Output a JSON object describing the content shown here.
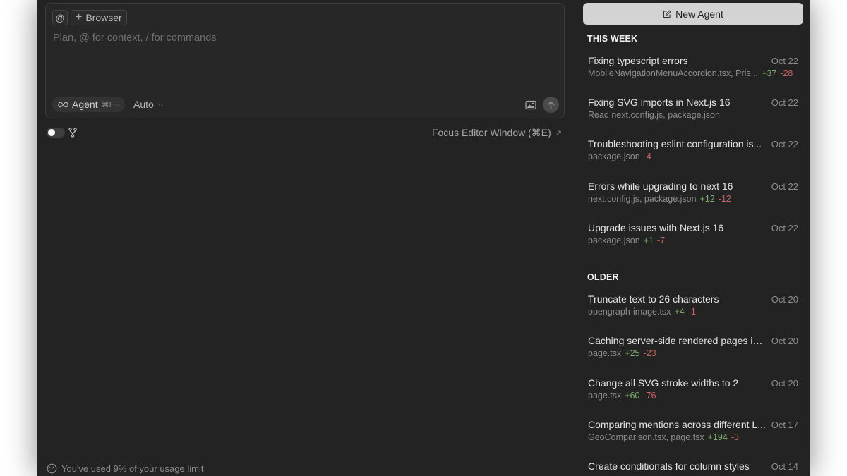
{
  "composer": {
    "at_label": "@",
    "browser_label": "Browser",
    "placeholder": "Plan, @ for context, / for commands",
    "mode_label": "Agent",
    "mode_shortcut": "⌘I",
    "model_label": "Auto"
  },
  "focus_editor": {
    "label": "Focus Editor Window (⌘E)"
  },
  "usage": {
    "text": "You've used 9% of your usage limit"
  },
  "sidebar": {
    "new_agent_label": "New Agent",
    "sections": [
      {
        "title": "THIS WEEK",
        "items": [
          {
            "title": "Fixing typescript errors",
            "date": "Oct 22",
            "files": "MobileNavigationMenuAccordion.tsx, Pris...",
            "add": "+37",
            "del": "-28"
          },
          {
            "title": "Fixing SVG imports in Next.js 16",
            "date": "Oct 22",
            "files": "Read next.config.js, package.json",
            "add": "",
            "del": ""
          },
          {
            "title": "Troubleshooting eslint configuration is...",
            "date": "Oct 22",
            "files": "package.json",
            "add": "",
            "del": "-4"
          },
          {
            "title": "Errors while upgrading to next 16",
            "date": "Oct 22",
            "files": "next.config.js, package.json",
            "add": "+12",
            "del": "-12"
          },
          {
            "title": "Upgrade issues with Next.js 16",
            "date": "Oct 22",
            "files": "package.json",
            "add": "+1",
            "del": "-7"
          }
        ]
      },
      {
        "title": "OLDER",
        "items": [
          {
            "title": "Truncate text to 26 characters",
            "date": "Oct 20",
            "files": "opengraph-image.tsx",
            "add": "+4",
            "del": "-1"
          },
          {
            "title": "Caching server-side rendered pages in...",
            "date": "Oct 20",
            "files": "page.tsx",
            "add": "+25",
            "del": "-23"
          },
          {
            "title": "Change all SVG stroke widths to 2",
            "date": "Oct 20",
            "files": "page.tsx",
            "add": "+60",
            "del": "-76"
          },
          {
            "title": "Comparing mentions across different L...",
            "date": "Oct 17",
            "files": "GeoComparison.tsx, page.tsx",
            "add": "+194",
            "del": "-3"
          },
          {
            "title": "Create conditionals for column styles",
            "date": "Oct 14",
            "files": "",
            "add": "",
            "del": ""
          }
        ]
      }
    ]
  }
}
